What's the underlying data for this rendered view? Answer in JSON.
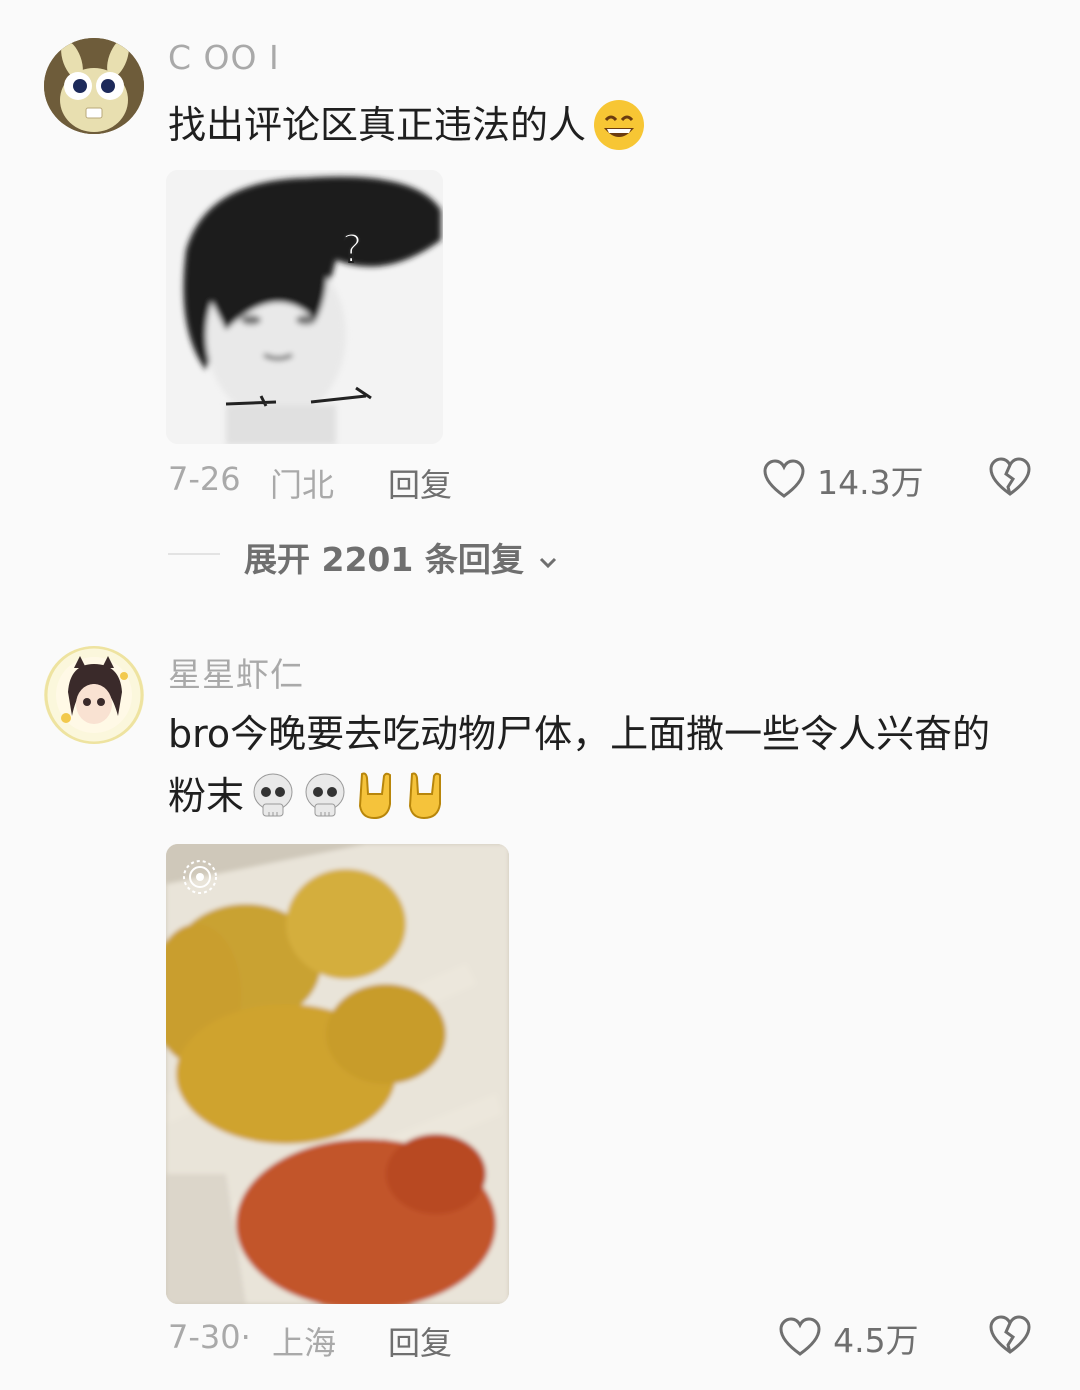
{
  "comments": [
    {
      "username": "C OO I",
      "text": "找出评论区真正违法的人",
      "emoji": "😄",
      "date": "7-26",
      "location": "门北",
      "reply_label": "回复",
      "likes": "14.3万",
      "expand_label": "展开 2201 条回复",
      "image_name": "question-face-sketch"
    },
    {
      "username": "星星虾仁",
      "text": "bro今晚要去吃动物尸体，上面撒一些令人兴奋的粉末",
      "emojis": [
        "💀",
        "💀",
        "🤘",
        "🤘"
      ],
      "date": "7-30·",
      "location": "上海",
      "reply_label": "回复",
      "likes": "4.5万",
      "image_name": "fried-chicken-box-photo"
    }
  ],
  "icons": {
    "like": "heart-outline-icon",
    "dislike": "broken-heart-icon",
    "expand_chevron": "chevron-down-icon",
    "live_photo": "live-photo-icon"
  },
  "colors": {
    "background": "#fafafa",
    "meta_text": "#a9a9a9",
    "action_text": "#6f6f6f"
  }
}
